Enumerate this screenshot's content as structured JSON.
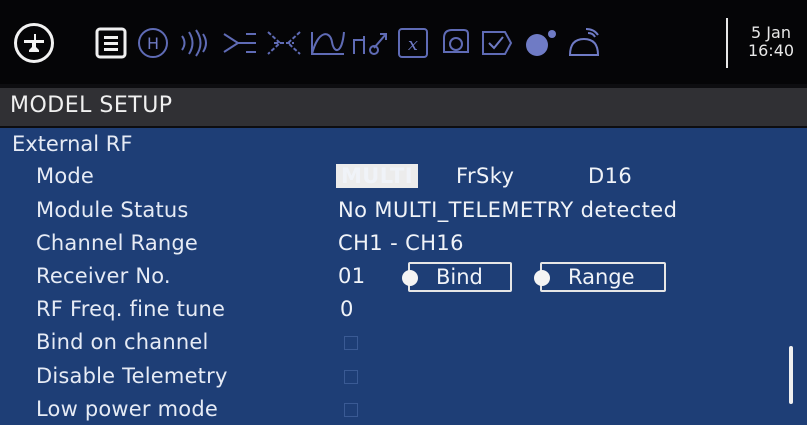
{
  "header": {
    "date": "5 Jan",
    "time": "16:40",
    "icons": [
      "radio-menu-icon",
      "model-list-icon",
      "heli-icon",
      "radio-waves-icon",
      "inputs-icon",
      "mixer-icon",
      "curves-icon",
      "logical-switches-icon",
      "custom-scripts-icon",
      "special-functions-icon",
      "telemetry-check-icon",
      "display-icon",
      "gvars-icon",
      "signal-icon"
    ]
  },
  "page": {
    "title": "MODEL SETUP"
  },
  "section": {
    "title": "External RF"
  },
  "rows": {
    "mode": {
      "label": "Mode",
      "value": "MULTI",
      "protocol": "FrSky",
      "subtype": "D16"
    },
    "status": {
      "label": "Module Status",
      "value": "No MULTI_TELEMETRY detected"
    },
    "channels": {
      "label": "Channel Range",
      "value": "CH1 - CH16"
    },
    "receiver": {
      "label": "Receiver No.",
      "value": "01",
      "bind_label": "Bind",
      "range_label": "Range"
    },
    "finetune": {
      "label": "RF Freq. fine tune",
      "value": "0"
    },
    "bindch": {
      "label": "Bind on channel",
      "checked": false
    },
    "telemetry": {
      "label": "Disable Telemetry",
      "checked": false
    },
    "lowpower": {
      "label": "Low power mode",
      "checked": false
    }
  },
  "colors": {
    "panel": "#1e3e76",
    "titlebar": "#303034",
    "topbar": "#050507",
    "text": "#e6ebf5"
  }
}
